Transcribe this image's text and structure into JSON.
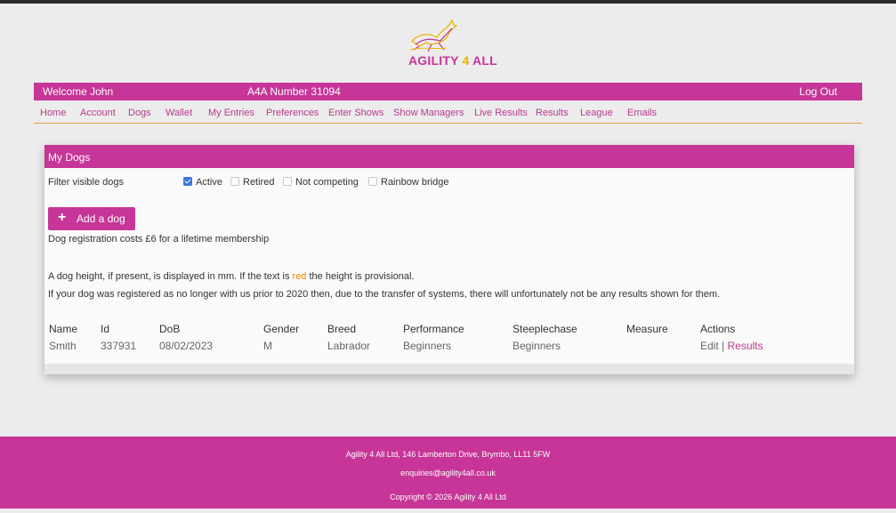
{
  "brand": {
    "logo_text_a": "AGILITY ",
    "logo_text_b": "4",
    "logo_text_c": " ALL",
    "primary_color": "#c63597",
    "accent_color": "#f0b400"
  },
  "header": {
    "welcome": "Welcome John",
    "a4a_number": "A4A Number 31094",
    "logout": "Log Out"
  },
  "nav": [
    "Home",
    "Account",
    "Dogs",
    "Wallet",
    "My Entries",
    "Preferences",
    "Enter Shows",
    "Show Managers",
    "Live Results",
    "Results",
    "League",
    "Emails"
  ],
  "card": {
    "title": "My Dogs",
    "filter_label": "Filter visible dogs",
    "filters": [
      {
        "label": "Active",
        "checked": true
      },
      {
        "label": "Retired",
        "checked": false
      },
      {
        "label": "Not competing",
        "checked": false
      },
      {
        "label": "Rainbow bridge",
        "checked": false
      }
    ],
    "add_button": "Add a dog",
    "registration_note": "Dog registration costs £6 for a lifetime membership",
    "height_note_a": "A dog height, if present, is displayed in mm. If the text is ",
    "height_note_red": "red",
    "height_note_b": " the height is provisional.",
    "transfer_note": "If your dog was registered as no longer with us prior to 2020 then, due to the transfer of systems, there will unfortunately not be any results shown for them."
  },
  "table": {
    "headers": [
      "Name",
      "Id",
      "DoB",
      "Gender",
      "Breed",
      "Performance",
      "Steeplechase",
      "Measure",
      "Actions"
    ],
    "rows": [
      {
        "name": "Smith",
        "id": "337931",
        "dob": "08/02/2023",
        "gender": "M",
        "breed": "Labrador",
        "performance": "Beginners",
        "steeplechase": "Beginners",
        "measure": "",
        "edit": "Edit",
        "sep": " | ",
        "results": "Results"
      }
    ]
  },
  "footer": {
    "address": "Agility 4 All Ltd, 146 Lamberton Drive, Brymbo, LL11 5FW",
    "email": "enquiries@agility4all.co.uk",
    "copyright": "Copyright © 2026 Agility 4 All Ltd"
  }
}
